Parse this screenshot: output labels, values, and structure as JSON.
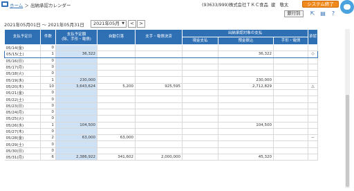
{
  "breadcrumb": {
    "home": "ホーム",
    "separator": "＞",
    "current": "出納承認カレンダー"
  },
  "header": {
    "company": "(93633/999)株式会社ＴＫＣ食品",
    "user": "建　敬太",
    "exit_label": "システム終了"
  },
  "toolbar": {
    "bank_label": "銀行別",
    "icons": [
      "external-link-icon",
      "print-icon",
      "help-icon"
    ]
  },
  "date_range": {
    "from": "2021年05月01日",
    "sep": "～",
    "to": "2021年05月31日"
  },
  "month_select": {
    "value": "2021年05月"
  },
  "nav": {
    "prev": "<",
    "next": ">"
  },
  "table": {
    "headers": {
      "date": "支払予定日",
      "count": "件数",
      "total": "支払予定額\n(除、手形・電債)",
      "auto": "自動引落",
      "payment": "支手・電債決済",
      "group": "出納承認対象の支払",
      "cash": "現金支払",
      "deposit": "預金振込",
      "note": "手形・電債",
      "approve": "承認"
    },
    "rows": [
      {
        "date": "05/14(金)",
        "count": "0",
        "total": "",
        "auto": "",
        "pay": "",
        "cash": "",
        "deposit": "",
        "note": "",
        "mark": ""
      },
      {
        "date": "05/15(土)",
        "count": "1",
        "total": "36,322",
        "auto": "",
        "pay": "",
        "cash": "",
        "deposit": "36,322",
        "note": "",
        "mark": "◇"
      },
      {
        "date": "05/16(日)",
        "count": "0",
        "total": "",
        "auto": "",
        "pay": "",
        "cash": "",
        "deposit": "",
        "note": "",
        "mark": ""
      },
      {
        "date": "05/17(月)",
        "count": "0",
        "total": "",
        "auto": "",
        "pay": "",
        "cash": "",
        "deposit": "",
        "note": "",
        "mark": ""
      },
      {
        "date": "05/18(火)",
        "count": "0",
        "total": "",
        "auto": "",
        "pay": "",
        "cash": "",
        "deposit": "",
        "note": "",
        "mark": ""
      },
      {
        "date": "05/19(水)",
        "count": "1",
        "total": "230,000",
        "auto": "",
        "pay": "",
        "cash": "",
        "deposit": "230,000",
        "note": "",
        "mark": ""
      },
      {
        "date": "05/20(木)",
        "count": "10",
        "total": "3,643,624",
        "auto": "5,200",
        "pay": "925,595",
        "cash": "",
        "deposit": "2,712,829",
        "note": "",
        "mark": "△"
      },
      {
        "date": "05/21(金)",
        "count": "0",
        "total": "",
        "auto": "",
        "pay": "",
        "cash": "",
        "deposit": "",
        "note": "",
        "mark": ""
      },
      {
        "date": "05/22(土)",
        "count": "0",
        "total": "",
        "auto": "",
        "pay": "",
        "cash": "",
        "deposit": "",
        "note": "",
        "mark": ""
      },
      {
        "date": "05/23(日)",
        "count": "0",
        "total": "",
        "auto": "",
        "pay": "",
        "cash": "",
        "deposit": "",
        "note": "",
        "mark": ""
      },
      {
        "date": "05/24(月)",
        "count": "0",
        "total": "",
        "auto": "",
        "pay": "",
        "cash": "",
        "deposit": "",
        "note": "",
        "mark": ""
      },
      {
        "date": "05/25(火)",
        "count": "0",
        "total": "",
        "auto": "",
        "pay": "",
        "cash": "",
        "deposit": "",
        "note": "",
        "mark": ""
      },
      {
        "date": "05/26(水)",
        "count": "1",
        "total": "104,500",
        "auto": "",
        "pay": "",
        "cash": "",
        "deposit": "104,500",
        "note": "",
        "mark": ""
      },
      {
        "date": "05/27(木)",
        "count": "0",
        "total": "",
        "auto": "",
        "pay": "",
        "cash": "",
        "deposit": "",
        "note": "",
        "mark": ""
      },
      {
        "date": "05/28(金)",
        "count": "2",
        "total": "63,000",
        "auto": "63,000",
        "pay": "",
        "cash": "",
        "deposit": "",
        "note": "",
        "mark": "－"
      },
      {
        "date": "05/29(土)",
        "count": "0",
        "total": "",
        "auto": "",
        "pay": "",
        "cash": "",
        "deposit": "",
        "note": "",
        "mark": ""
      },
      {
        "date": "05/30(日)",
        "count": "0",
        "total": "",
        "auto": "",
        "pay": "",
        "cash": "",
        "deposit": "",
        "note": "",
        "mark": ""
      },
      {
        "date": "05/31(月)",
        "count": "6",
        "total": "2,386,922",
        "auto": "341,602",
        "pay": "2,000,000",
        "cash": "",
        "deposit": "45,320",
        "note": "",
        "mark": ""
      }
    ]
  },
  "colors": {
    "header_bg": "#2f6fb4",
    "highlight_col": "#cfe2f5",
    "exit_btn": "#f08a1c",
    "link": "#2f6fb4"
  }
}
